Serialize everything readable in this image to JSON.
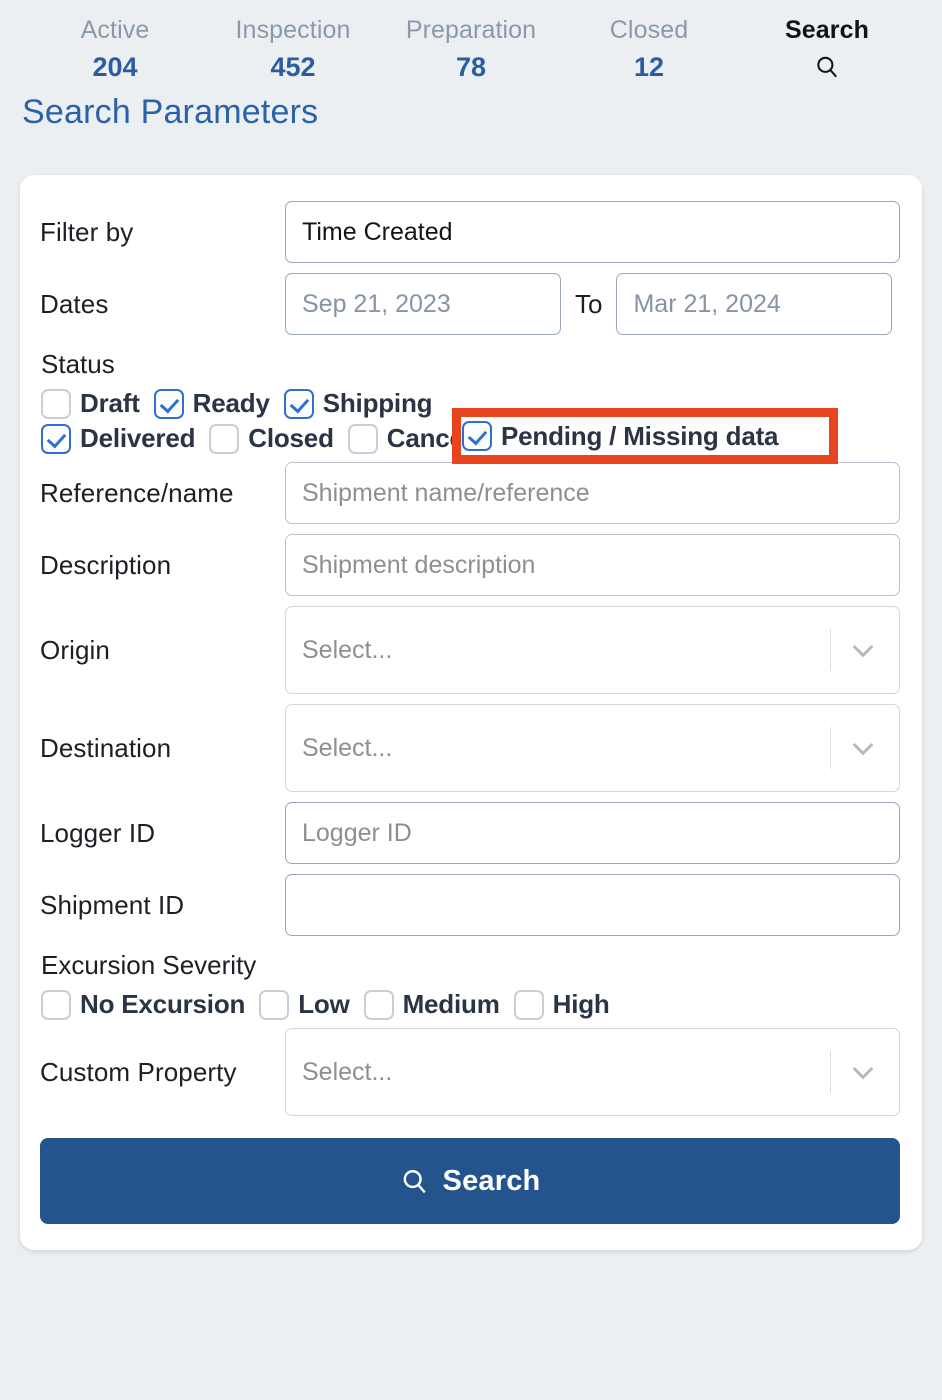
{
  "topnav": {
    "tabs": [
      {
        "label": "Active",
        "count": "204",
        "active": false
      },
      {
        "label": "Inspection",
        "count": "452",
        "active": false
      },
      {
        "label": "Preparation",
        "count": "78",
        "active": false
      },
      {
        "label": "Closed",
        "count": "12",
        "active": false
      }
    ],
    "search_tab": {
      "label": "Search",
      "icon": "search-icon"
    }
  },
  "page": {
    "title": "Search Parameters"
  },
  "form": {
    "filter_by": {
      "label": "Filter by",
      "value": "Time Created"
    },
    "dates": {
      "label": "Dates",
      "from_value": "Sep 21, 2023",
      "to_word": "To",
      "to_value": "Mar 21, 2024"
    },
    "status": {
      "label": "Status",
      "row1": [
        {
          "label": "Draft",
          "checked": false
        },
        {
          "label": "Ready",
          "checked": true
        },
        {
          "label": "Shipping",
          "checked": true
        },
        {
          "label": "Pending / Missing data",
          "checked": true,
          "highlighted": true
        }
      ],
      "row2": [
        {
          "label": "Delivered",
          "checked": true
        },
        {
          "label": "Closed",
          "checked": false
        },
        {
          "label": "Cancelled",
          "checked": false,
          "info_icon": "info-icon"
        }
      ]
    },
    "reference": {
      "label": "Reference/name",
      "placeholder": "Shipment name/reference",
      "value": ""
    },
    "description": {
      "label": "Description",
      "placeholder": "Shipment description",
      "value": ""
    },
    "origin": {
      "label": "Origin",
      "placeholder": "Select...",
      "value": ""
    },
    "destination": {
      "label": "Destination",
      "placeholder": "Select...",
      "value": ""
    },
    "logger_id": {
      "label": "Logger ID",
      "placeholder": "Logger ID",
      "value": ""
    },
    "shipment_id": {
      "label": "Shipment ID",
      "placeholder": "",
      "value": ""
    },
    "excursion": {
      "label": "Excursion Severity",
      "options": [
        {
          "label": "No Excursion",
          "checked": false
        },
        {
          "label": "Low",
          "checked": false
        },
        {
          "label": "Medium",
          "checked": false
        },
        {
          "label": "High",
          "checked": false
        }
      ]
    },
    "custom_property": {
      "label": "Custom Property",
      "placeholder": "Select...",
      "value": ""
    },
    "submit": {
      "label": "Search",
      "icon": "search-icon"
    }
  },
  "colors": {
    "page_bg": "#eceff2",
    "accent_blue": "#2a62a8",
    "count_blue": "#2a5d9f",
    "nav_label_gray": "#8a99aa",
    "checkbox_blue": "#2f6fd0",
    "button_blue": "#24548e",
    "highlight_red": "#e8441f"
  }
}
